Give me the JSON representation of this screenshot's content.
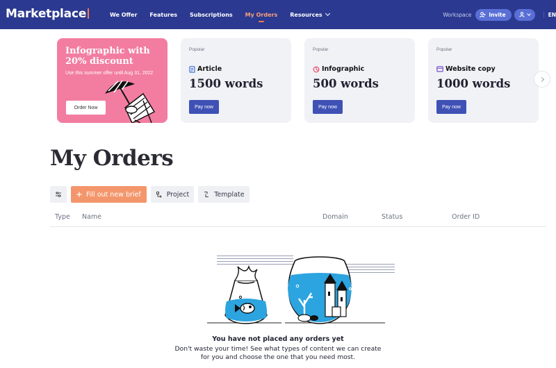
{
  "app": {
    "logo": "Marketplace"
  },
  "nav": {
    "items": [
      {
        "label": "We Offer"
      },
      {
        "label": "Features"
      },
      {
        "label": "Subscriptions"
      },
      {
        "label": "My Orders"
      },
      {
        "label": "Resources"
      }
    ],
    "workspace": "Workspace",
    "invite": "Invite",
    "lang": "EN"
  },
  "promo": {
    "title": "Infographic with 20% discount",
    "subtitle": "Use this summer offer until Aug 31, 2022",
    "button": "Order Now"
  },
  "cards": [
    {
      "tag": "Popular",
      "type": "Article",
      "words": "1500 words",
      "button": "Pay now",
      "icon": "article-icon"
    },
    {
      "tag": "Popular",
      "type": "Infographic",
      "words": "500 words",
      "button": "Pay now",
      "icon": "infographic-icon"
    },
    {
      "tag": "Popular",
      "type": "Website copy",
      "words": "1000 words",
      "button": "Pay now",
      "icon": "website-icon"
    }
  ],
  "orders": {
    "title": "My Orders",
    "toolbar": {
      "new_brief": "Fill out new brief",
      "project": "Project",
      "template": "Template"
    },
    "columns": [
      "Type",
      "Name",
      "Domain",
      "Status",
      "Order ID"
    ],
    "empty": {
      "title": "You have not placed any orders yet",
      "subtitle": "Don't waste your time! See what types of content we can create for you and choose the one that you need most."
    }
  },
  "colors": {
    "nav_bg": "#2b3990",
    "accent": "#f47b51",
    "promo_bg": "#f27da0",
    "pay_btn": "#3f51b5",
    "primary_btn": "#f4966c"
  }
}
